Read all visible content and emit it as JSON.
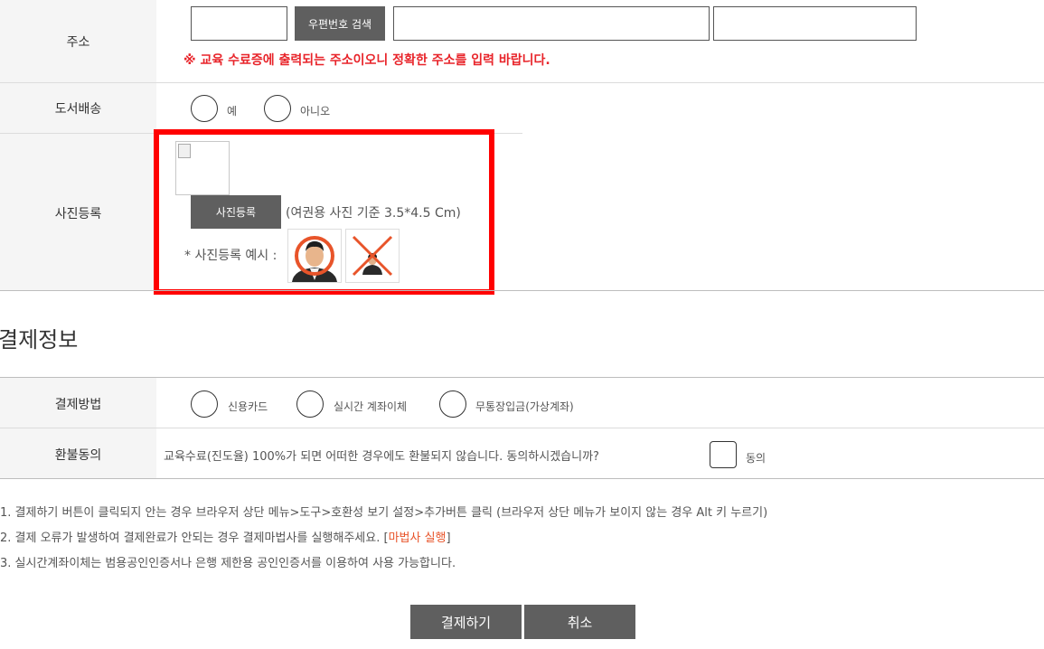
{
  "address": {
    "label": "주소",
    "postcode_button": "우편번호 검색",
    "warning": "※ 교육 수료증에 출력되는 주소이오니 정확한 주소를 입력 바랍니다."
  },
  "book_delivery": {
    "label": "도서배송",
    "options": [
      "예",
      "아니오"
    ]
  },
  "photo": {
    "label": "사진등록",
    "upload_button": "사진등록",
    "size_hint": "(여권용 사진 기준 3.5*4.5 Cm)",
    "example_label": "* 사진등록 예시 :"
  },
  "payment_section": {
    "title": "결제정보"
  },
  "payment_method": {
    "label": "결제방법",
    "options": [
      "신용카드",
      "실시간 계좌이체",
      "무통장입금(가상계좌)"
    ]
  },
  "refund": {
    "label": "환불동의",
    "text": "교육수료(진도율) 100%가 되면 어떠한 경우에도 환불되지 않습니다. 동의하시겠습니까?",
    "agree_label": "동의"
  },
  "notes": {
    "n1": "1. 결제하기 버튼이 클릭되지 안는 경우 브라우저 상단 메뉴>도구>호환성 보기 설정>추가버튼 클릭 (브라우저 상단 메뉴가 보이지 않는 경우 Alt 키 누르기)",
    "n2_prefix": "2. 결제 오류가 발생하여 결제완료가 안되는 경우 결제마법사를 실행해주세요. [",
    "n2_link": "마법사 실행",
    "n2_suffix": "]",
    "n3": "3. 실시간계좌이체는 범용공인인증서나 은행 제한용 공인인증서를 이용하여 사용 가능합니다."
  },
  "actions": {
    "pay": "결제하기",
    "cancel": "취소"
  },
  "colors": {
    "warning_red": "#e8242a",
    "highlight_border": "#ff0000",
    "button_gray": "#5f5f5f",
    "link_orange": "#e8542a"
  }
}
